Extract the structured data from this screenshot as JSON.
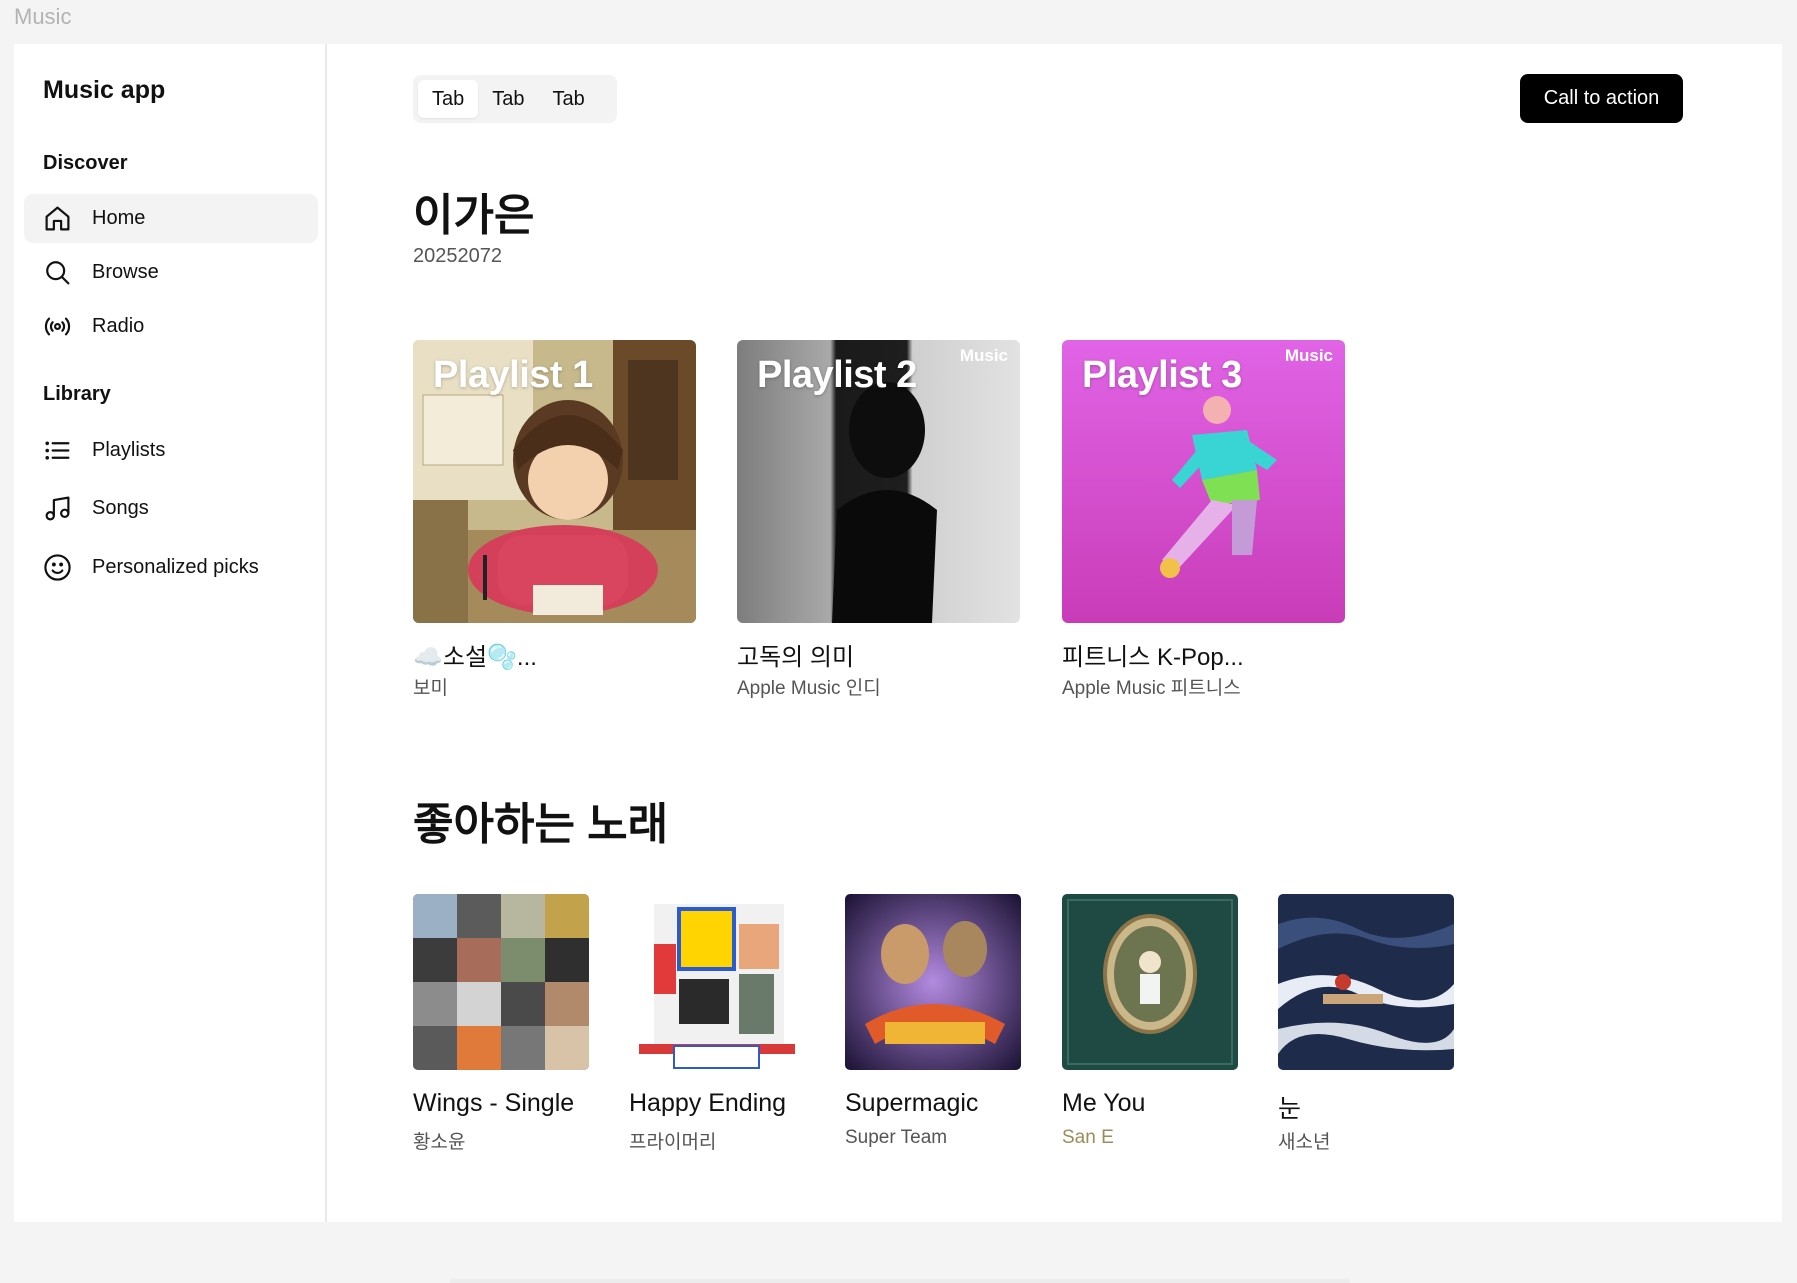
{
  "window": {
    "title": "Music"
  },
  "sidebar": {
    "app_title": "Music app",
    "discover_label": "Discover",
    "discover_items": [
      {
        "label": "Home",
        "icon": "home-icon",
        "active": true
      },
      {
        "label": "Browse",
        "icon": "search-icon"
      },
      {
        "label": "Radio",
        "icon": "radio-icon"
      }
    ],
    "library_label": "Library",
    "library_items": [
      {
        "label": "Playlists",
        "icon": "list-icon"
      },
      {
        "label": "Songs",
        "icon": "music-note-icon"
      },
      {
        "label": "Personalized picks",
        "icon": "smiley-icon"
      }
    ]
  },
  "header": {
    "tabs": [
      "Tab",
      "Tab",
      "Tab"
    ],
    "cta_label": "Call to action"
  },
  "profile": {
    "name": "이가은",
    "id": "20252072"
  },
  "playlists": [
    {
      "cover_title": "Playlist 1",
      "title": "☁️소설🫧...",
      "subtitle": "보미",
      "badge": ""
    },
    {
      "cover_title": "Playlist 2",
      "title": "고독의 의미",
      "subtitle": "Apple Music 인디",
      "badge": "Music"
    },
    {
      "cover_title": "Playlist 3",
      "title": "피트니스 K-Pop...",
      "subtitle": "Apple Music 피트니스",
      "badge": "Music"
    }
  ],
  "songs_section": {
    "title": "좋아하는 노래"
  },
  "songs": [
    {
      "title": "Wings - Single",
      "artist": "황소윤"
    },
    {
      "title": "Happy Ending",
      "artist": "프라이머리"
    },
    {
      "title": "Supermagic",
      "artist": "Super Team"
    },
    {
      "title": "Me You",
      "artist": "San E",
      "accent": "#9a8c5b"
    },
    {
      "title": "눈",
      "artist": "새소년"
    }
  ],
  "colors": {
    "accent": "#000000",
    "active_nav_bg": "#f3f3f3",
    "app_bg": "#f4f4f4"
  }
}
